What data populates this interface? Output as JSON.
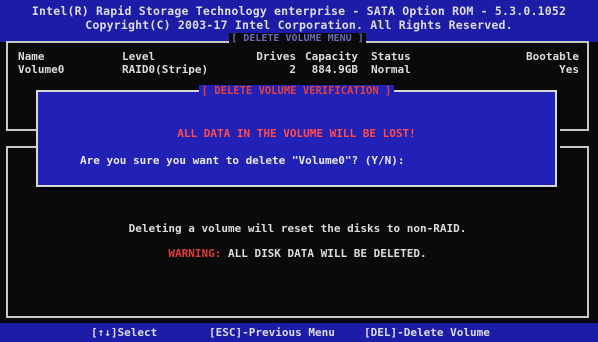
{
  "header": {
    "line1": "Intel(R) Rapid Storage Technology enterprise - SATA Option ROM - 5.3.0.1052",
    "line2": "Copyright(C) 2003-17 Intel Corporation.  All Rights Reserved."
  },
  "delete_menu": {
    "title": "[ DELETE VOLUME MENU ]",
    "columns": {
      "name": "Name",
      "level": "Level",
      "drives": "Drives",
      "capacity": "Capacity",
      "status": "Status",
      "bootable": "Bootable"
    },
    "volume": {
      "name": "Volume0",
      "level": "RAID0(Stripe)",
      "drives": "2",
      "capacity": "884.9GB",
      "status": "Normal",
      "bootable": "Yes"
    }
  },
  "dialog": {
    "title": "[ DELETE VOLUME VERIFICATION ]",
    "warning": "ALL DATA IN THE VOLUME WILL BE LOST!",
    "prompt": "Are you sure you want to delete \"Volume0\"? (Y/N):"
  },
  "info": {
    "line1": "Deleting a volume will reset the disks to non-RAID.",
    "warning_label": "WARNING:",
    "warning_text": " ALL DISK DATA WILL BE DELETED."
  },
  "footer": {
    "select": "[↑↓]Select",
    "esc": "[ESC]-Previous Menu",
    "del": "[DEL]-Delete Volume"
  },
  "colors": {
    "title_bar": "#1c1ca6",
    "dialog_bg": "#2121b6",
    "warning_red": "#e04040",
    "text": "#dcdcdc",
    "background": "#0a0a0a"
  }
}
